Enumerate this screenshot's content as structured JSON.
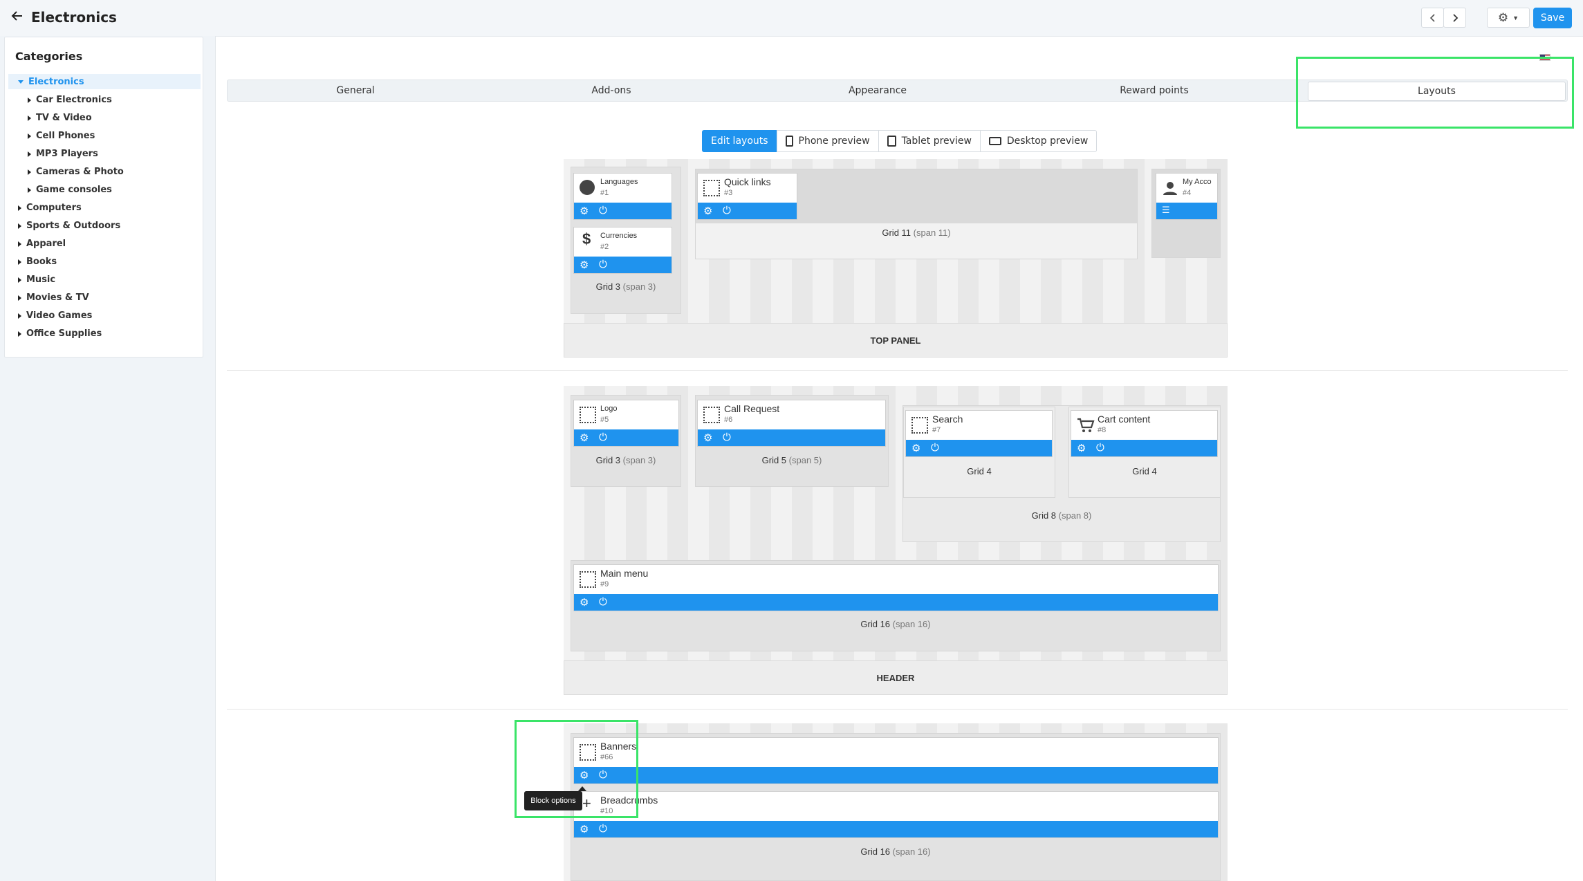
{
  "header": {
    "title": "Electronics",
    "save_label": "Save"
  },
  "sidebar": {
    "title": "Categories",
    "items": [
      {
        "label": "Electronics",
        "level": 0,
        "open": true,
        "active": true
      },
      {
        "label": "Car Electronics",
        "level": 1
      },
      {
        "label": "TV & Video",
        "level": 1
      },
      {
        "label": "Cell Phones",
        "level": 1
      },
      {
        "label": "MP3 Players",
        "level": 1
      },
      {
        "label": "Cameras & Photo",
        "level": 1
      },
      {
        "label": "Game consoles",
        "level": 1
      },
      {
        "label": "Computers",
        "level": 0
      },
      {
        "label": "Sports & Outdoors",
        "level": 0
      },
      {
        "label": "Apparel",
        "level": 0
      },
      {
        "label": "Books",
        "level": 0
      },
      {
        "label": "Music",
        "level": 0
      },
      {
        "label": "Movies & TV",
        "level": 0
      },
      {
        "label": "Video Games",
        "level": 0
      },
      {
        "label": "Office Supplies",
        "level": 0
      }
    ]
  },
  "tabs": [
    "General",
    "Add-ons",
    "Appearance",
    "Reward points",
    "Layouts"
  ],
  "active_tab": "Layouts",
  "modes": [
    "Edit layouts",
    "Phone preview",
    "Tablet preview",
    "Desktop preview"
  ],
  "active_mode": "Edit layouts",
  "sections": {
    "top_panel": "TOP PANEL",
    "header": "HEADER"
  },
  "grids": {
    "g_tp3": {
      "name": "Grid 3",
      "span": "(span 3)"
    },
    "g_tp11": {
      "name": "Grid 11",
      "span": "(span 11)"
    },
    "g_h3": {
      "name": "Grid 3",
      "span": "(span 3)"
    },
    "g_h5": {
      "name": "Grid 5",
      "span": "(span 5)"
    },
    "g_h4a": {
      "name": "Grid 4",
      "span": ""
    },
    "g_h4b": {
      "name": "Grid 4",
      "span": ""
    },
    "g_h8": {
      "name": "Grid 8",
      "span": "(span 8)"
    },
    "g_h16": {
      "name": "Grid 16",
      "span": "(span 16)"
    },
    "g_c16": {
      "name": "Grid 16",
      "span": "(span 16)"
    }
  },
  "blocks": {
    "languages": {
      "name": "Languages",
      "id": "#1"
    },
    "currencies": {
      "name": "Currencies",
      "id": "#2"
    },
    "quick_links": {
      "name": "Quick links",
      "id": "#3"
    },
    "my_account": {
      "name": "My Acco",
      "id": "#4"
    },
    "logo": {
      "name": "Logo",
      "id": "#5"
    },
    "call_request": {
      "name": "Call Request",
      "id": "#6"
    },
    "search": {
      "name": "Search",
      "id": "#7"
    },
    "cart_content": {
      "name": "Cart content",
      "id": "#8"
    },
    "main_menu": {
      "name": "Main menu",
      "id": "#9"
    },
    "banners": {
      "name": "Banners",
      "id": "#66"
    },
    "breadcrumbs": {
      "name": "Breadcrumbs",
      "id": "#10"
    }
  },
  "tooltip": "Block options"
}
